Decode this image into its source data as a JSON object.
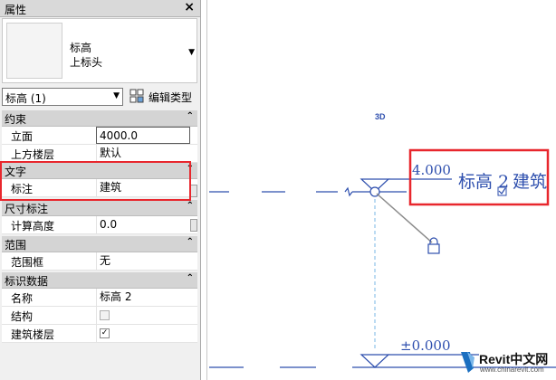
{
  "panel": {
    "title": "属性",
    "close_glyph": "×",
    "type_family": "标高",
    "type_name": "上标头",
    "instance_selector": "标高 (1)",
    "edit_type_label": "编辑类型",
    "collapse_glyph": "«"
  },
  "groups": [
    {
      "label": "约束",
      "rows": [
        {
          "key": "立面",
          "value": "4000.0",
          "editing": true
        },
        {
          "key": "上方楼层",
          "value": "默认"
        }
      ]
    },
    {
      "label": "文字",
      "rows": [
        {
          "key": "标注",
          "value": "建筑"
        }
      ]
    },
    {
      "label": "尺寸标注",
      "rows": [
        {
          "key": "计算高度",
          "value": "0.0"
        }
      ]
    },
    {
      "label": "范围",
      "rows": [
        {
          "key": "范围框",
          "value": "无"
        }
      ]
    },
    {
      "label": "标识数据",
      "rows": [
        {
          "key": "名称",
          "value": "标高 2"
        },
        {
          "key": "结构",
          "checkbox": false
        },
        {
          "key": "建筑楼层",
          "checkbox": true
        }
      ]
    }
  ],
  "canvas": {
    "view_3d_label": "3D",
    "level_upper_elevation": "4.000",
    "level_upper_name": "标高 2",
    "level_upper_tag": "建筑",
    "level_lower_elevation": "±0.000",
    "colors": {
      "level_line": "#2e4fae",
      "highlight": "#e8272d",
      "dashed": "#8fc3e8"
    }
  },
  "watermark": {
    "brand": "Revit中文网",
    "url": "www.chinarevit.com"
  }
}
